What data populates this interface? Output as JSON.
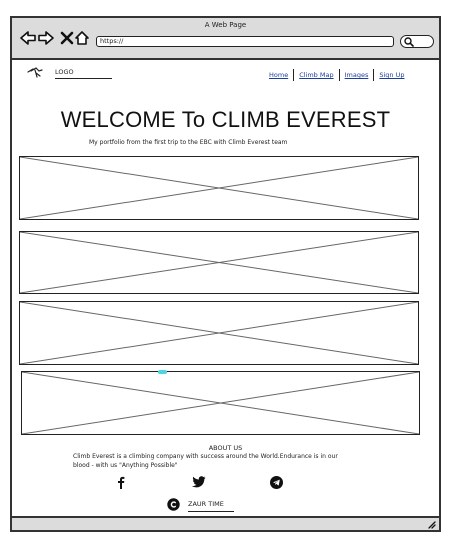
{
  "window": {
    "title": "A Web Page",
    "url": "https://"
  },
  "header": {
    "logo_text": "LOGO",
    "nav": [
      {
        "label": "Home"
      },
      {
        "label": "Climb Map"
      },
      {
        "label": "Images"
      },
      {
        "label": "Sign Up"
      }
    ]
  },
  "hero": {
    "headline": "WELCOME To CLIMB EVEREST",
    "subtitle": "My portfolio from the first trip to the EBC with Climb Everest team"
  },
  "gallery": {
    "image_count": 4
  },
  "about": {
    "title": "ABOUT US",
    "text": "Climb Everest is a climbing company with success around the World.Endurance is in our blood - with us \"Anything Possible\""
  },
  "footer": {
    "social_icons": [
      "facebook-icon",
      "twitter-icon",
      "telegram-icon"
    ],
    "copyright_icon": "copyright-icon",
    "author": "ZAUR TIME"
  },
  "colors": {
    "chrome": "#dcdcdc",
    "link": "#1a3e9a",
    "stroke": "#222222",
    "cursor": "#4dd6e0"
  }
}
